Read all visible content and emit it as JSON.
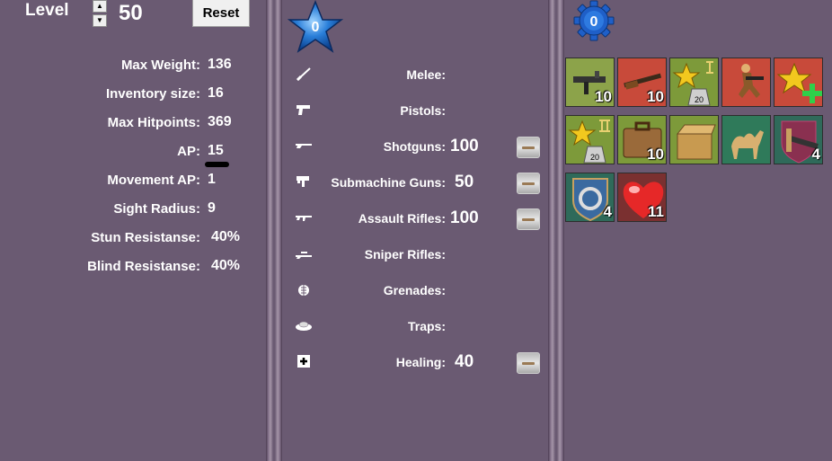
{
  "level": {
    "label": "Level",
    "value": "50",
    "reset_label": "Reset"
  },
  "stats": [
    {
      "label": "Max Weight:",
      "value": "136"
    },
    {
      "label": "Inventory size:",
      "value": "16"
    },
    {
      "label": "Max Hitpoints:",
      "value": "369"
    },
    {
      "label": "AP:",
      "value": "15"
    },
    {
      "label": "Movement AP:",
      "value": "1"
    },
    {
      "label": "Sight Radius:",
      "value": "9"
    },
    {
      "label": "Stun Resistanse:",
      "value": "40%"
    },
    {
      "label": "Blind Resistanse:",
      "value": "40%"
    }
  ],
  "skill_points": "0",
  "skills": [
    {
      "label": "Melee:",
      "value": "",
      "icon": "knife-icon"
    },
    {
      "label": "Pistols:",
      "value": "",
      "icon": "pistol-icon"
    },
    {
      "label": "Shotguns:",
      "value": "100",
      "icon": "shotgun-icon"
    },
    {
      "label": "Submachine Guns:",
      "value": "50",
      "icon": "smg-icon"
    },
    {
      "label": "Assault Rifles:",
      "value": "100",
      "icon": "rifle-icon"
    },
    {
      "label": "Sniper Rifles:",
      "value": "",
      "icon": "sniper-icon"
    },
    {
      "label": "Grenades:",
      "value": "",
      "icon": "grenade-icon"
    },
    {
      "label": "Traps:",
      "value": "",
      "icon": "trap-icon"
    },
    {
      "label": "Healing:",
      "value": "40",
      "icon": "medkit-icon"
    }
  ],
  "perk_points": "0",
  "perks": [
    {
      "icon": "smg-perk-icon",
      "count": "10"
    },
    {
      "icon": "shotgun-perk-icon",
      "count": "10"
    },
    {
      "icon": "star-weight-perk-icon",
      "count": ""
    },
    {
      "icon": "soldier-run-perk-icon",
      "count": ""
    },
    {
      "icon": "star-plus-perk-icon",
      "count": ""
    },
    {
      "icon": "star-weight-2-perk-icon",
      "count": ""
    },
    {
      "icon": "suitcase-perk-icon",
      "count": "10"
    },
    {
      "icon": "box-perk-icon",
      "count": ""
    },
    {
      "icon": "camel-perk-icon",
      "count": ""
    },
    {
      "icon": "shield-knife-perk-icon",
      "count": "4"
    },
    {
      "icon": "shield-shuriken-perk-icon",
      "count": "4"
    },
    {
      "icon": "heart-perk-icon",
      "count": "11"
    }
  ],
  "colors": {
    "panel": "#6a5a72",
    "star": "#2a7fd9",
    "gear": "#1f5fc8"
  }
}
